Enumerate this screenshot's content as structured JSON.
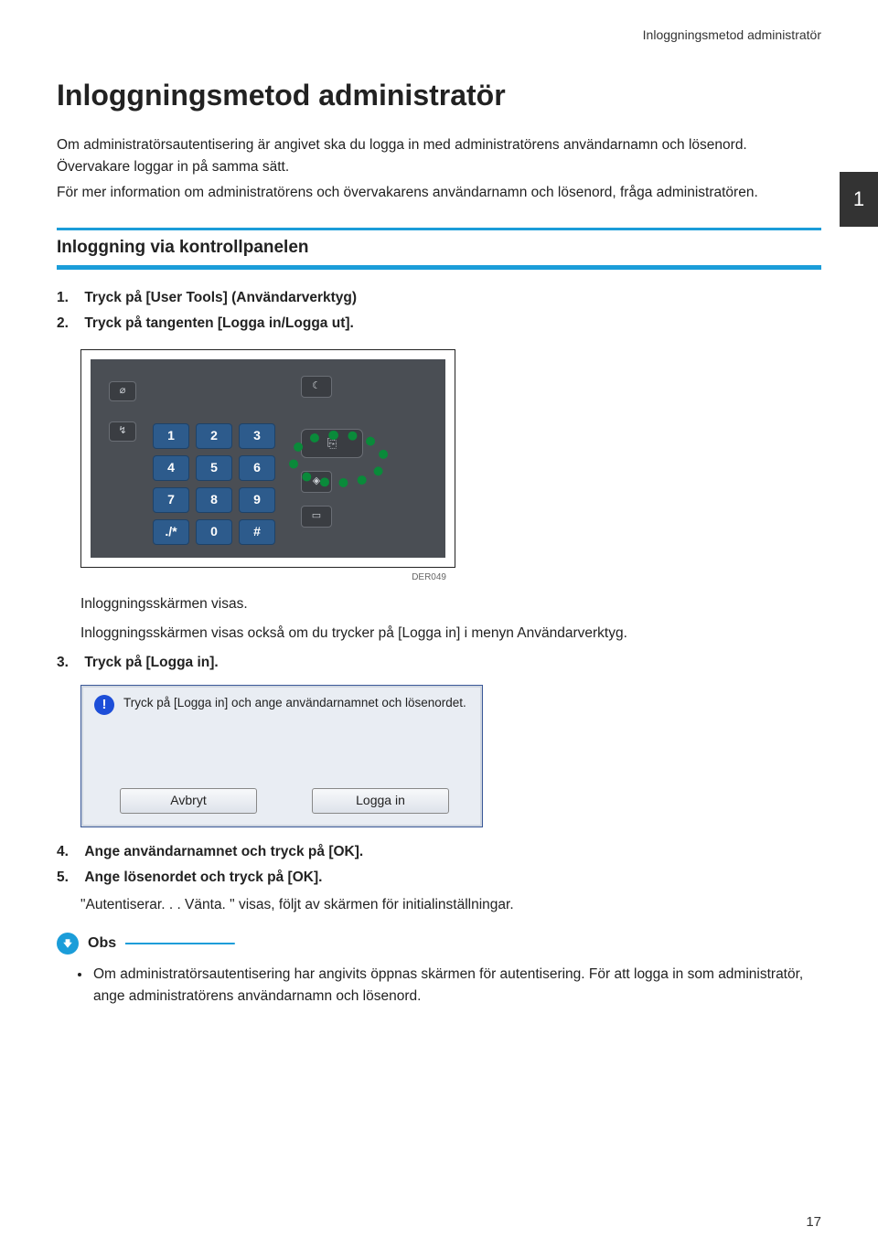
{
  "header": {
    "running_title": "Inloggningsmetod administratör"
  },
  "chapter_tab": "1",
  "title": "Inloggningsmetod administratör",
  "intro": {
    "p1": "Om administratörsautentisering är angivet ska du logga in med administratörens användarnamn och lösenord. Övervakare loggar in på samma sätt.",
    "p2": "För mer information om administratörens och övervakarens användarnamn och lösenord, fråga administratören."
  },
  "section_heading": "Inloggning via kontrollpanelen",
  "steps": {
    "s1_num": "1.",
    "s1_text": "Tryck på [User Tools] (Användarverktyg)",
    "s2_num": "2.",
    "s2_text": "Tryck på tangenten [Logga in/Logga ut].",
    "panel": {
      "keys": [
        "1",
        "2",
        "3",
        "4",
        "5",
        "6",
        "7",
        "8",
        "9",
        "./*",
        "0",
        "#"
      ],
      "img_label": "DER049"
    },
    "after_panel_1": "Inloggningsskärmen visas.",
    "after_panel_2": "Inloggningsskärmen visas också om du trycker på [Logga in] i menyn Användarverktyg.",
    "s3_num": "3.",
    "s3_text": "Tryck på [Logga in].",
    "dialog": {
      "message": "Tryck på [Logga in] och ange användarnamnet och lösenordet.",
      "cancel": "Avbryt",
      "login": "Logga in"
    },
    "s4_num": "4.",
    "s4_text": "Ange användarnamnet och tryck på [OK].",
    "s5_num": "5.",
    "s5_text": "Ange lösenordet och tryck på [OK].",
    "after5": "\"Autentiserar. . . Vänta. \" visas, följt av skärmen för initialinställningar."
  },
  "obs": {
    "label": "Obs",
    "bullet": "Om administratörsautentisering har angivits öppnas skärmen för autentisering. För att logga in som administratör, ange administratörens användarnamn och lösenord."
  },
  "page_number": "17"
}
